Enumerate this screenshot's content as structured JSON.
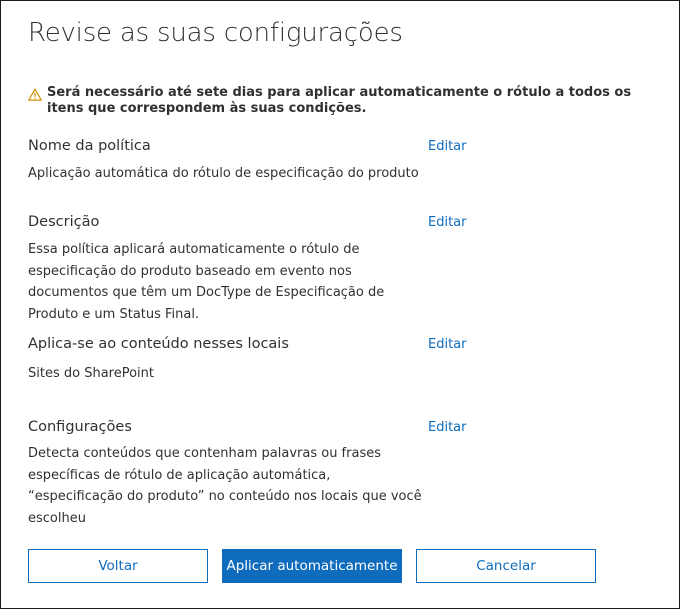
{
  "page": {
    "title": "Revise as suas configurações"
  },
  "warning": {
    "icon": "warning-icon",
    "color": "#d29200",
    "text": "Será necessário até sete dias para aplicar automaticamente o rótulo a todos os itens que correspondem às suas condições."
  },
  "sections": [
    {
      "heading": "Nome da política",
      "edit_label": "Editar",
      "body": "Aplicação automática do rótulo de especificação do produto"
    },
    {
      "heading": "Descrição",
      "edit_label": "Editar",
      "body": "Essa política aplicará automaticamente o rótulo de especificação do produto baseado em evento nos documentos que têm um DocType de Especificação de Produto e um Status Final."
    },
    {
      "heading": "Aplica-se ao conteúdo nesses locais",
      "edit_label": "Editar",
      "body": "Sites do SharePoint"
    },
    {
      "heading": "Configurações",
      "edit_label": "Editar",
      "body": "Detecta conteúdos que contenham palavras ou frases específicas de rótulo de aplicação automática, “especificação do produto” no conteúdo nos locais que você escolheu"
    }
  ],
  "footer": {
    "back_label": "Voltar",
    "apply_label": "Aplicar automaticamente",
    "cancel_label": "Cancelar"
  },
  "colors": {
    "accent": "#0f6cbd",
    "text": "#323130"
  }
}
